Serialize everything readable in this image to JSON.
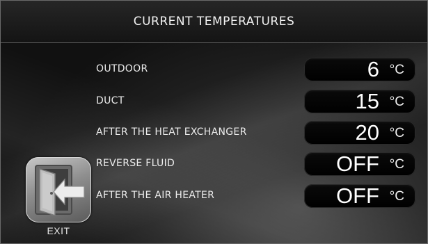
{
  "header": {
    "title": "CURRENT TEMPERATURES"
  },
  "rows": [
    {
      "label": "OUTDOOR",
      "value": "6",
      "unit": "°C"
    },
    {
      "label": "DUCT",
      "value": "15",
      "unit": "°C"
    },
    {
      "label": "AFTER THE HEAT EXCHANGER",
      "value": "20",
      "unit": "°C"
    },
    {
      "label": "REVERSE FLUID",
      "value": "OFF",
      "unit": "°C"
    },
    {
      "label": "AFTER THE AIR HEATER",
      "value": "OFF",
      "unit": "°C"
    }
  ],
  "exit": {
    "label": "EXIT",
    "icon": "exit-door-icon"
  }
}
